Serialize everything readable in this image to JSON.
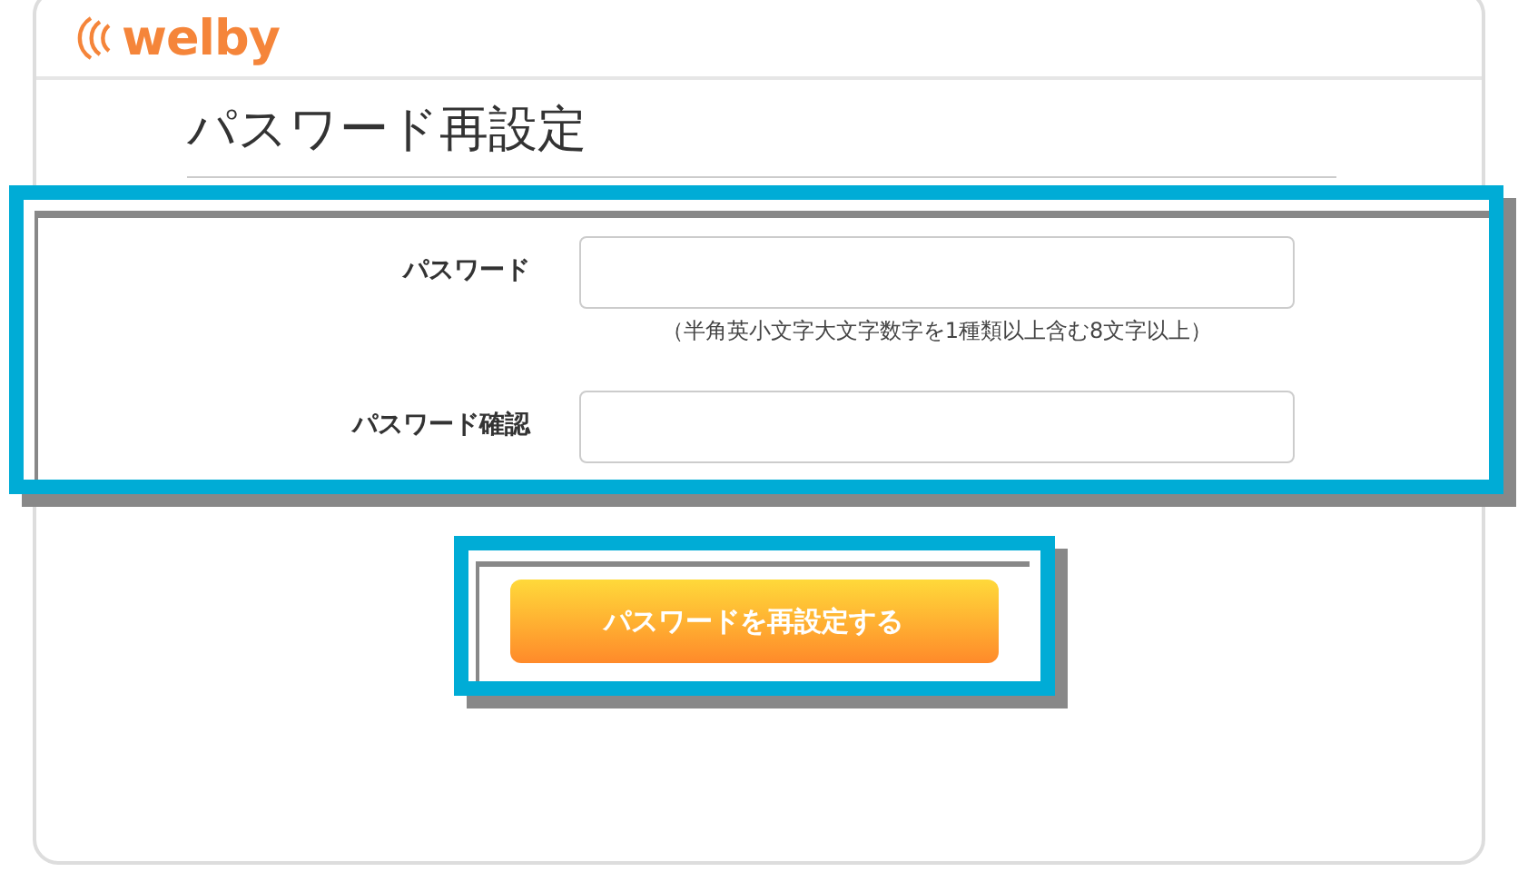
{
  "logo": {
    "text": "welby"
  },
  "title": "パスワード再設定",
  "fields": [
    {
      "label": "パスワード",
      "hint": "（半角英小文字大文字数字を1種類以上含む8文字以上）"
    },
    {
      "label": "パスワード確認"
    }
  ],
  "submit_button": {
    "label": "パスワードを再設定する"
  }
}
